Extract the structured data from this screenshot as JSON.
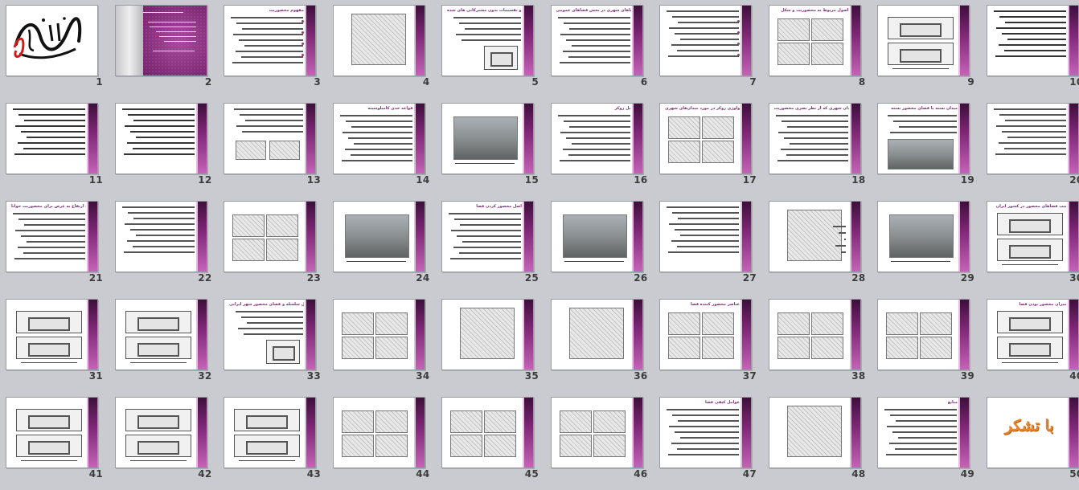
{
  "app": "Slide Sorter",
  "slides": [
    {
      "n": "1",
      "kind": "calligraphy"
    },
    {
      "n": "2",
      "kind": "cover"
    },
    {
      "n": "3",
      "kind": "text",
      "title": "مفهوم محصوریت"
    },
    {
      "n": "4",
      "kind": "image-sketch"
    },
    {
      "n": "5",
      "kind": "text-plan",
      "title": "اصول ساماندهی و تقسیمات بدون مشترکاتی های شده"
    },
    {
      "n": "6",
      "kind": "text",
      "title": "در سیستم فضاهای شهری در بخش فضاهای عمومی"
    },
    {
      "n": "7",
      "kind": "text"
    },
    {
      "n": "8",
      "kind": "grid-images",
      "title": "اصول مربوط به محصوریت و شکل"
    },
    {
      "n": "9",
      "kind": "plans"
    },
    {
      "n": "10",
      "kind": "text"
    },
    {
      "n": "11",
      "kind": "text"
    },
    {
      "n": "12",
      "kind": "text"
    },
    {
      "n": "13",
      "kind": "text-images"
    },
    {
      "n": "14",
      "kind": "text",
      "title": "قواعد حدی کامیلوسیته"
    },
    {
      "n": "15",
      "kind": "photo"
    },
    {
      "n": "16",
      "kind": "text",
      "title": "پل زوکر"
    },
    {
      "n": "17",
      "kind": "grid-images",
      "title": "تیپولوژی زوکر در مورد میدان‌های شهری"
    },
    {
      "n": "18",
      "kind": "text",
      "title": "زوکر نیز تیپ میدان شهری که از نظر بصری محصوریت"
    },
    {
      "n": "19",
      "kind": "text-photo",
      "title": "میدان بسته یا فضای محصور بسته"
    },
    {
      "n": "20",
      "kind": "text"
    },
    {
      "n": "21",
      "kind": "text",
      "title": "نسبت ارتفاع به عرض برای محصوریت خوانا"
    },
    {
      "n": "22",
      "kind": "text"
    },
    {
      "n": "23",
      "kind": "grid-images"
    },
    {
      "n": "24",
      "kind": "photo"
    },
    {
      "n": "25",
      "kind": "text",
      "title": "اصل محصور کردن فضا"
    },
    {
      "n": "26",
      "kind": "photo"
    },
    {
      "n": "27",
      "kind": "text"
    },
    {
      "n": "28",
      "kind": "image-sketch"
    },
    {
      "n": "29",
      "kind": "photo"
    },
    {
      "n": "30",
      "kind": "plans",
      "title": "تیپ فضاهای محصور در کشور ایران"
    },
    {
      "n": "31",
      "kind": "plans"
    },
    {
      "n": "32",
      "kind": "plans"
    },
    {
      "n": "33",
      "kind": "text-plan",
      "title": "اصل سلسله و فضای محصور شهر ایرانی"
    },
    {
      "n": "34",
      "kind": "grid-images"
    },
    {
      "n": "35",
      "kind": "image-sketch"
    },
    {
      "n": "36",
      "kind": "image-sketch"
    },
    {
      "n": "37",
      "kind": "grid-images",
      "title": "عناصر محصور کننده فضا"
    },
    {
      "n": "38",
      "kind": "grid-images"
    },
    {
      "n": "39",
      "kind": "grid-images"
    },
    {
      "n": "40",
      "kind": "plans",
      "title": "میزان محصور بودن فضا"
    },
    {
      "n": "41",
      "kind": "plans"
    },
    {
      "n": "42",
      "kind": "plans"
    },
    {
      "n": "43",
      "kind": "plans"
    },
    {
      "n": "44",
      "kind": "grid-images"
    },
    {
      "n": "45",
      "kind": "grid-images"
    },
    {
      "n": "46",
      "kind": "grid-images"
    },
    {
      "n": "47",
      "kind": "text",
      "title": "عوامل کیفی فضا"
    },
    {
      "n": "48",
      "kind": "image-sketch"
    },
    {
      "n": "49",
      "kind": "text",
      "title": "منابع"
    },
    {
      "n": "50",
      "kind": "thanks",
      "text": "با تشکر"
    }
  ],
  "cover": {
    "line1": "به نام خدا"
  }
}
